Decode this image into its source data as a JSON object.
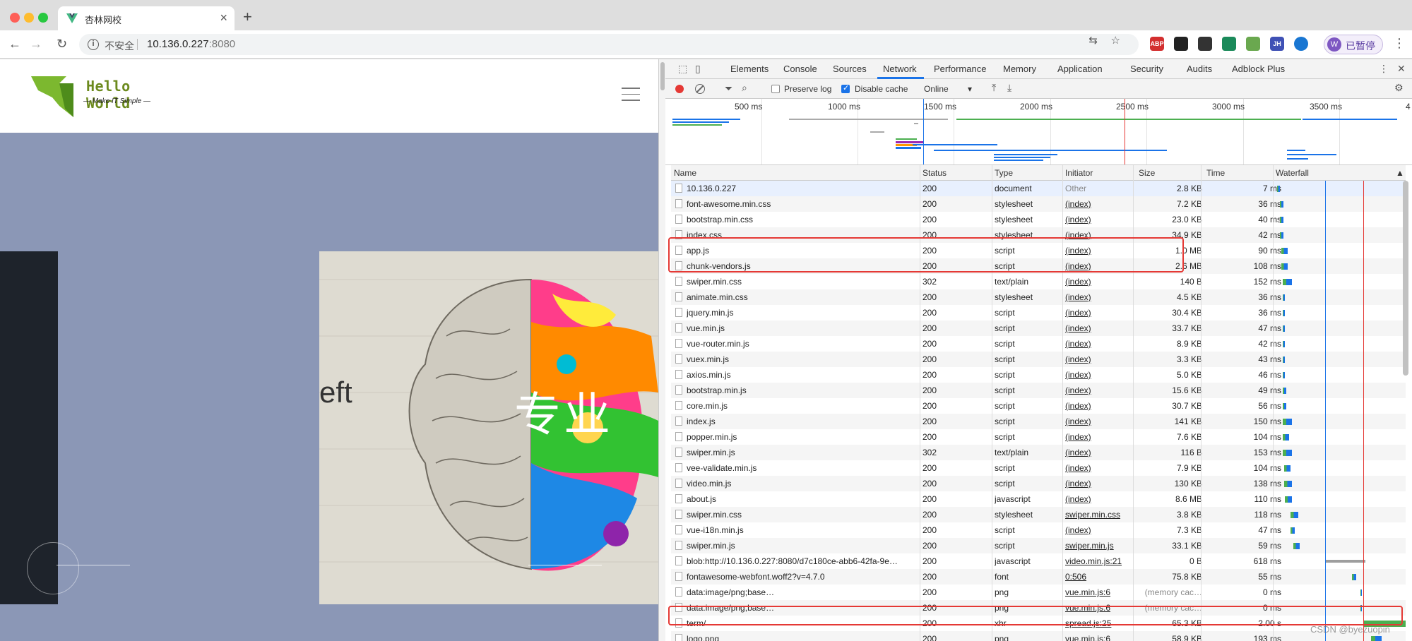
{
  "tab": {
    "title": "杏林网校",
    "close": "×",
    "new_tab": "+"
  },
  "address": {
    "insecure_label": "不安全",
    "url_host": "10.136.0.227",
    "url_port": ":8080"
  },
  "toolbar": {
    "back": "←",
    "forward": "→",
    "reload": "↻",
    "menu": "⋮"
  },
  "profile": {
    "initial": "W",
    "label": "已暂停"
  },
  "extensions": [
    "ABP",
    "JH"
  ],
  "site": {
    "logo_title": "Hello World",
    "logo_subtitle": "— Make IT Simple —",
    "hero_cn": "专业",
    "hero_partial": "eft"
  },
  "devtools": {
    "tabs": [
      "Elements",
      "Console",
      "Sources",
      "Network",
      "Performance",
      "Memory",
      "Application",
      "Security",
      "Audits",
      "Adblock Plus"
    ],
    "active_tab": "Network",
    "preserve_log": "Preserve log",
    "disable_cache": "Disable cache",
    "throttle": "Online",
    "overview_ticks": [
      "500 ms",
      "1000 ms",
      "1500 ms",
      "2000 ms",
      "2500 ms",
      "3000 ms",
      "3500 ms",
      "4"
    ],
    "columns": [
      "Name",
      "Status",
      "Type",
      "Initiator",
      "Size",
      "Time",
      "Waterfall"
    ],
    "rows": [
      {
        "name": "10.136.0.227",
        "status": "200",
        "type": "document",
        "initiator": "Other",
        "size": "2.8 KB",
        "time": "7 ms"
      },
      {
        "name": "font-awesome.min.css",
        "status": "200",
        "type": "stylesheet",
        "initiator": "(index)",
        "size": "7.2 KB",
        "time": "36 ms"
      },
      {
        "name": "bootstrap.min.css",
        "status": "200",
        "type": "stylesheet",
        "initiator": "(index)",
        "size": "23.0 KB",
        "time": "40 ms"
      },
      {
        "name": "index.css",
        "status": "200",
        "type": "stylesheet",
        "initiator": "(index)",
        "size": "34.9 KB",
        "time": "42 ms"
      },
      {
        "name": "app.js",
        "status": "200",
        "type": "script",
        "initiator": "(index)",
        "size": "1.0 MB",
        "time": "90 ms"
      },
      {
        "name": "chunk-vendors.js",
        "status": "200",
        "type": "script",
        "initiator": "(index)",
        "size": "2.6 MB",
        "time": "108 ms"
      },
      {
        "name": "swiper.min.css",
        "status": "302",
        "type": "text/plain",
        "initiator": "(index)",
        "size": "140 B",
        "time": "152 ms"
      },
      {
        "name": "animate.min.css",
        "status": "200",
        "type": "stylesheet",
        "initiator": "(index)",
        "size": "4.5 KB",
        "time": "36 ms"
      },
      {
        "name": "jquery.min.js",
        "status": "200",
        "type": "script",
        "initiator": "(index)",
        "size": "30.4 KB",
        "time": "36 ms"
      },
      {
        "name": "vue.min.js",
        "status": "200",
        "type": "script",
        "initiator": "(index)",
        "size": "33.7 KB",
        "time": "47 ms"
      },
      {
        "name": "vue-router.min.js",
        "status": "200",
        "type": "script",
        "initiator": "(index)",
        "size": "8.9 KB",
        "time": "42 ms"
      },
      {
        "name": "vuex.min.js",
        "status": "200",
        "type": "script",
        "initiator": "(index)",
        "size": "3.3 KB",
        "time": "43 ms"
      },
      {
        "name": "axios.min.js",
        "status": "200",
        "type": "script",
        "initiator": "(index)",
        "size": "5.0 KB",
        "time": "46 ms"
      },
      {
        "name": "bootstrap.min.js",
        "status": "200",
        "type": "script",
        "initiator": "(index)",
        "size": "15.6 KB",
        "time": "49 ms"
      },
      {
        "name": "core.min.js",
        "status": "200",
        "type": "script",
        "initiator": "(index)",
        "size": "30.7 KB",
        "time": "56 ms"
      },
      {
        "name": "index.js",
        "status": "200",
        "type": "script",
        "initiator": "(index)",
        "size": "141 KB",
        "time": "150 ms"
      },
      {
        "name": "popper.min.js",
        "status": "200",
        "type": "script",
        "initiator": "(index)",
        "size": "7.6 KB",
        "time": "104 ms"
      },
      {
        "name": "swiper.min.js",
        "status": "302",
        "type": "text/plain",
        "initiator": "(index)",
        "size": "116 B",
        "time": "153 ms"
      },
      {
        "name": "vee-validate.min.js",
        "status": "200",
        "type": "script",
        "initiator": "(index)",
        "size": "7.9 KB",
        "time": "104 ms"
      },
      {
        "name": "video.min.js",
        "status": "200",
        "type": "script",
        "initiator": "(index)",
        "size": "130 KB",
        "time": "138 ms"
      },
      {
        "name": "about.js",
        "status": "200",
        "type": "javascript",
        "initiator": "(index)",
        "size": "8.6 MB",
        "time": "110 ms"
      },
      {
        "name": "swiper.min.css",
        "status": "200",
        "type": "stylesheet",
        "initiator": "swiper.min.css",
        "size": "3.8 KB",
        "time": "118 ms"
      },
      {
        "name": "vue-i18n.min.js",
        "status": "200",
        "type": "script",
        "initiator": "(index)",
        "size": "7.3 KB",
        "time": "47 ms"
      },
      {
        "name": "swiper.min.js",
        "status": "200",
        "type": "script",
        "initiator": "swiper.min.js",
        "size": "33.1 KB",
        "time": "59 ms"
      },
      {
        "name": "blob:http://10.136.0.227:8080/d7c180ce-abb6-42fa-9e…",
        "status": "200",
        "type": "javascript",
        "initiator": "video.min.js:21",
        "size": "0 B",
        "time": "618 ms"
      },
      {
        "name": "fontawesome-webfont.woff2?v=4.7.0",
        "status": "200",
        "type": "font",
        "initiator": "0:506",
        "size": "75.8 KB",
        "time": "55 ms"
      },
      {
        "name": "data:image/png;base…",
        "status": "200",
        "type": "png",
        "initiator": "vue.min.js:6",
        "size": "(memory cac…",
        "time": "0 ms"
      },
      {
        "name": "data:image/png;base…",
        "status": "200",
        "type": "png",
        "initiator": "vue.min.js:6",
        "size": "(memory cac…",
        "time": "0 ms"
      },
      {
        "name": "term/",
        "status": "200",
        "type": "xhr",
        "initiator": "spread.js:25",
        "size": "65.3 KB",
        "time": "2.00 s"
      },
      {
        "name": "logo.png",
        "status": "200",
        "type": "png",
        "initiator": "vue.min.js:6",
        "size": "58.9 KB",
        "time": "193 ms"
      }
    ]
  },
  "watermark": "CSDN @byezuopin",
  "colors": {
    "record": "#e53935",
    "accent": "#1a73e8",
    "highlight": "#e53935",
    "page_bg": "#8b97b6"
  }
}
